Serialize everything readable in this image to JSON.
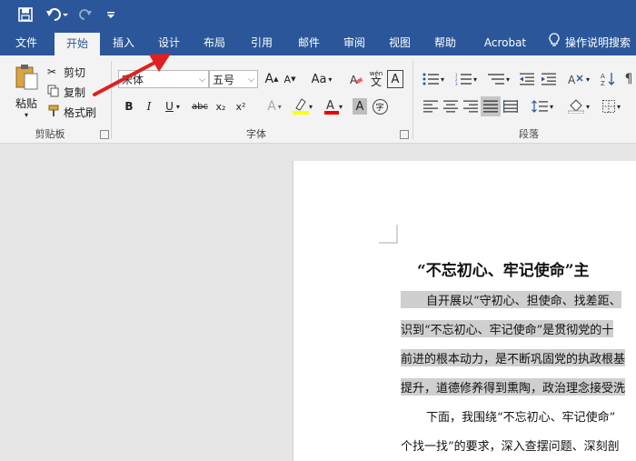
{
  "qat": {
    "save_icon": "save-icon",
    "undo_icon": "undo-icon",
    "redo_icon": "redo-icon",
    "customize_icon": "customize-icon"
  },
  "tabs": [
    {
      "label": "文件"
    },
    {
      "label": "开始"
    },
    {
      "label": "插入"
    },
    {
      "label": "设计"
    },
    {
      "label": "布局"
    },
    {
      "label": "引用"
    },
    {
      "label": "邮件"
    },
    {
      "label": "审阅"
    },
    {
      "label": "视图"
    },
    {
      "label": "帮助"
    },
    {
      "label": "Acrobat"
    }
  ],
  "tell_me": {
    "label": "操作说明搜索"
  },
  "clipboard": {
    "paste": "粘贴",
    "cut": "剪切",
    "copy": "复制",
    "format_painter": "格式刷",
    "group_label": "剪贴板"
  },
  "font": {
    "font_name": "宋体",
    "font_size": "五号",
    "grow": "A",
    "shrink": "A",
    "case": "Aa",
    "bold": "B",
    "italic": "I",
    "underline": "U",
    "strike": "abc",
    "sub": "x₂",
    "sup": "x²",
    "group_label": "字体",
    "clear_format": "A",
    "wen": "wén",
    "border_a": "A",
    "shade_a": "A",
    "circle_char": "字"
  },
  "paragraph": {
    "group_label": "段落"
  },
  "document": {
    "title": "“不忘初心、牢记使命”主",
    "lines": [
      "自开展以“守初心、担使命、找差距、",
      "识到“不忘初心、牢记使命”是贯彻党的十",
      "前进的根本动力，是不断巩固党的执政根基",
      "提升，道德修养得到熏陶，政治理念接受洗",
      "下面，我围绕“不忘初心、牢记使命”",
      "个找一找”的要求，深入查摆问题、深刻剖"
    ]
  },
  "colors": {
    "accent": "#2b579a",
    "ribbon_bg": "#f3f3f3",
    "highlight": "#cfcfcf",
    "arrow": "#e02020"
  }
}
